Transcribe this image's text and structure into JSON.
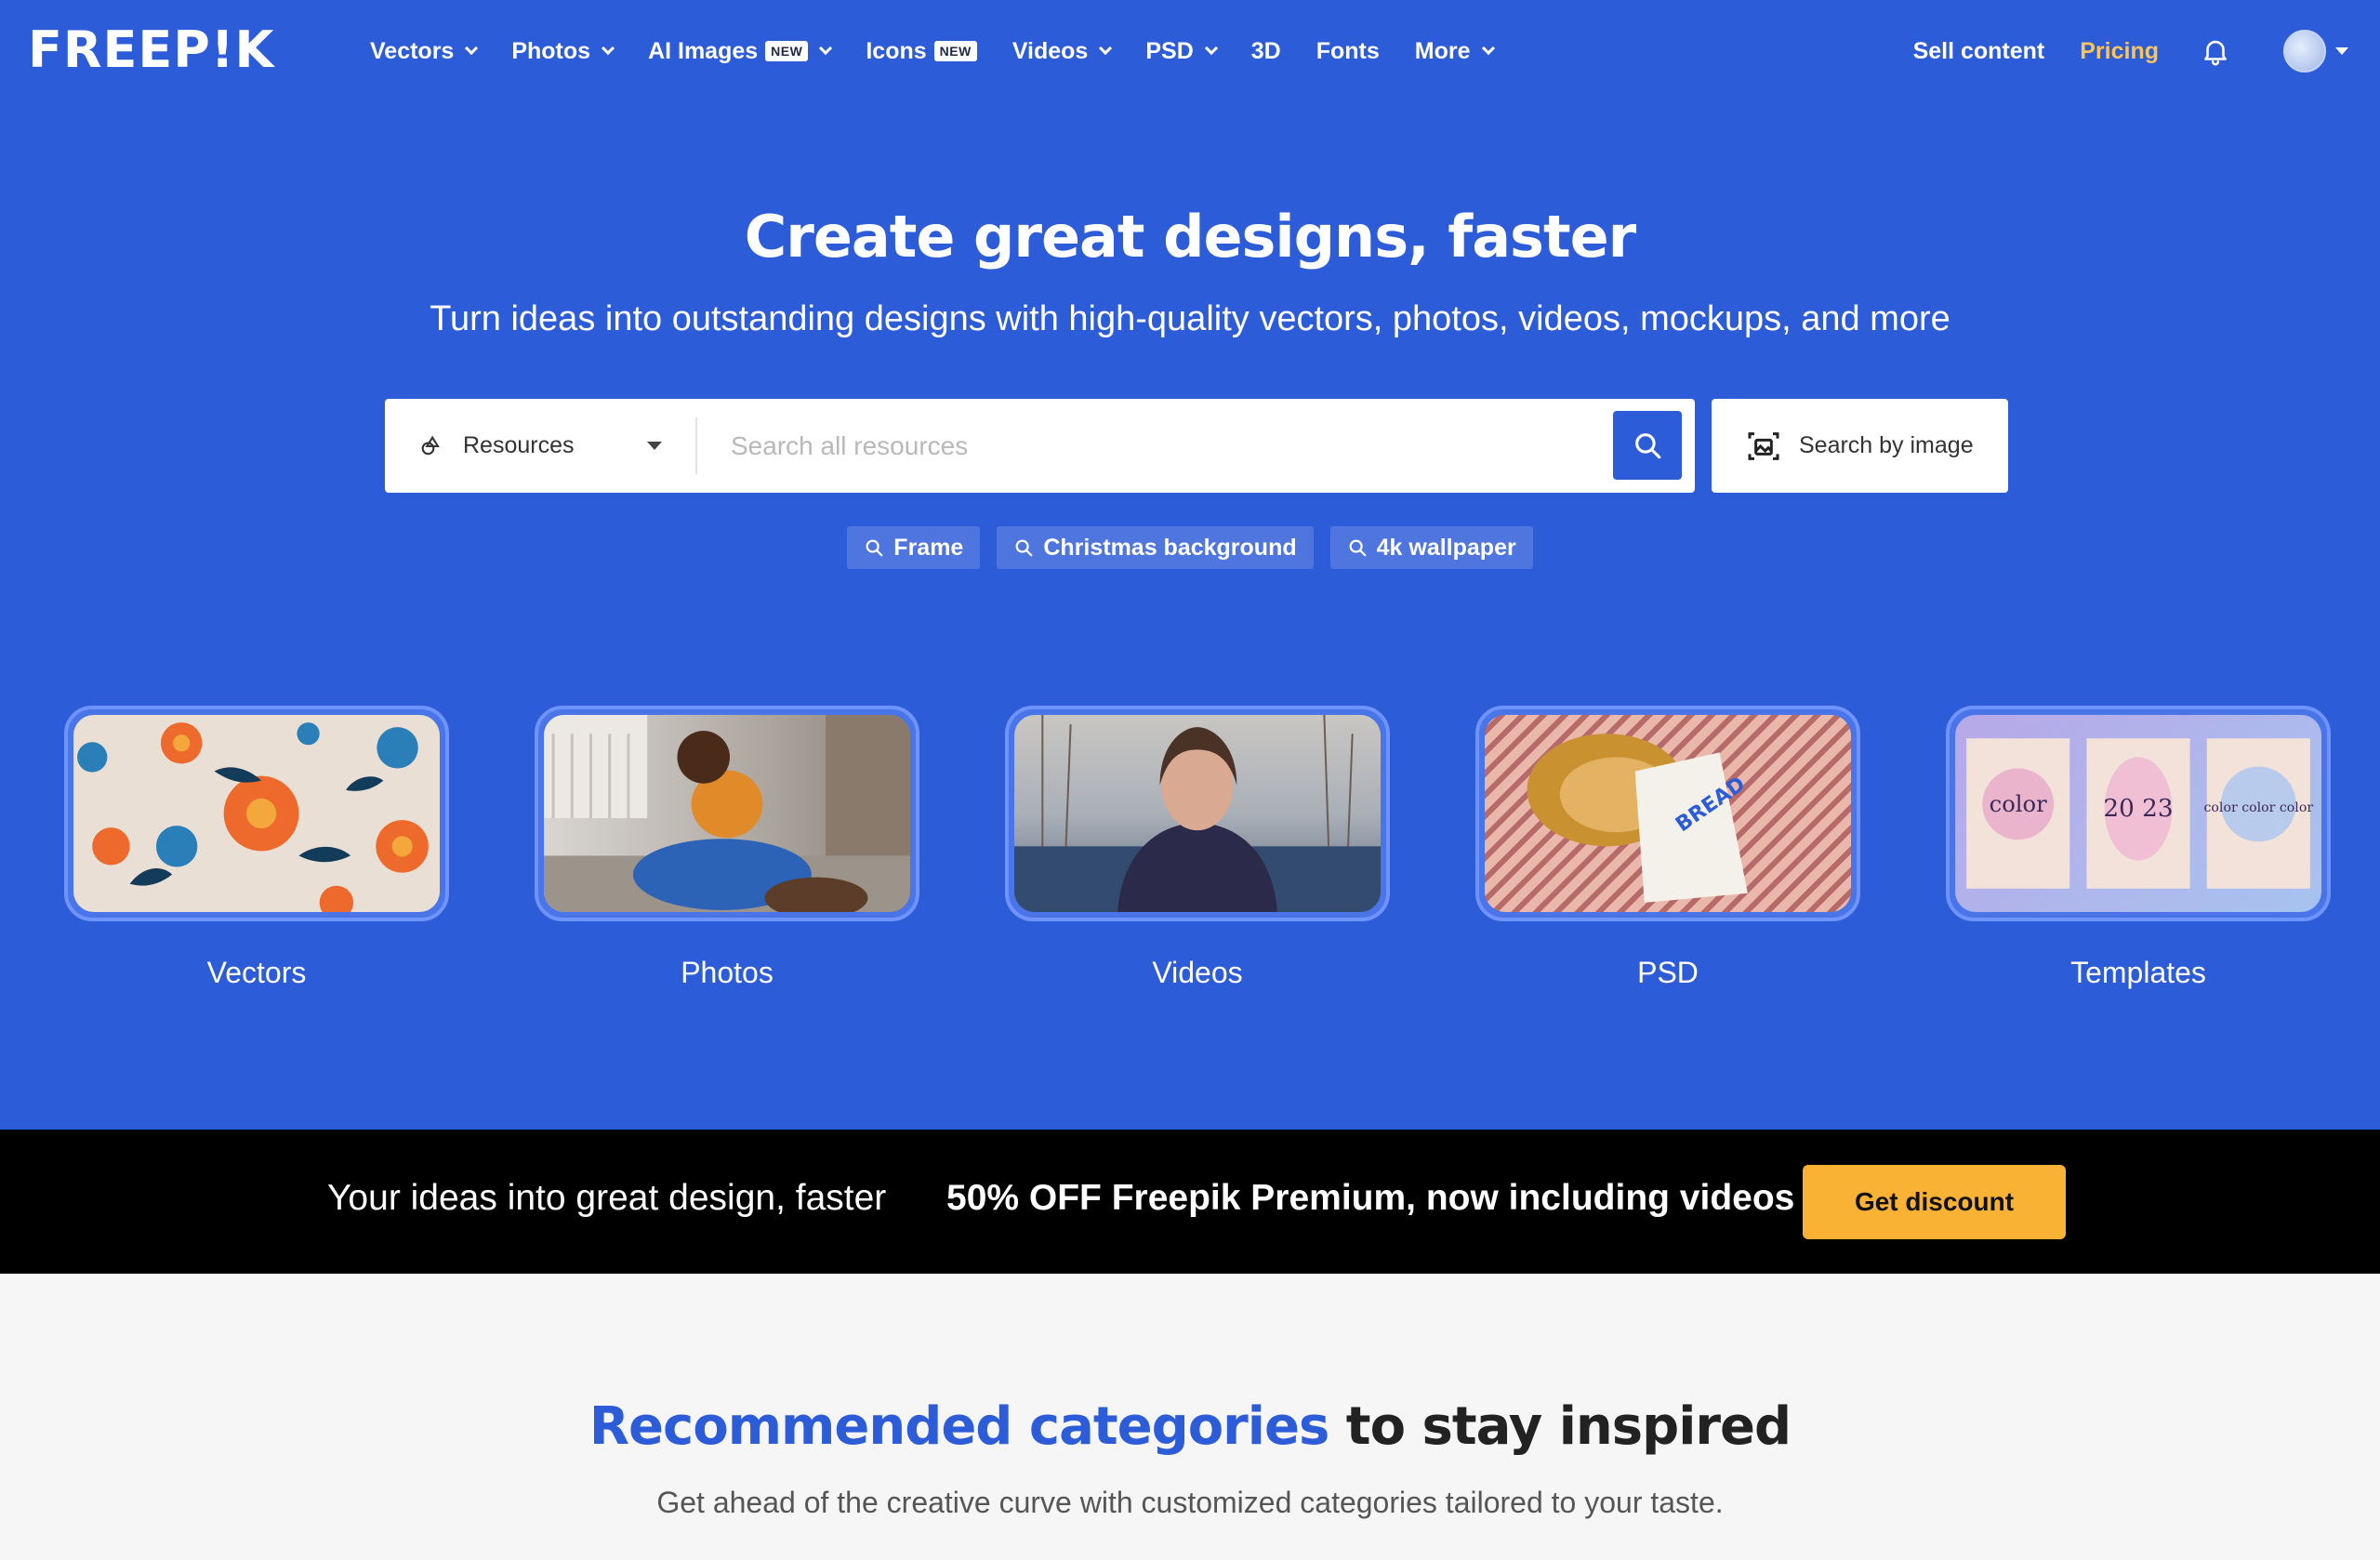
{
  "brand": {
    "logo_text": "FREEP!K"
  },
  "nav": {
    "items": [
      {
        "label": "Vectors",
        "dropdown": true,
        "badge": ""
      },
      {
        "label": "Photos",
        "dropdown": true,
        "badge": ""
      },
      {
        "label": "AI Images",
        "dropdown": true,
        "badge": "NEW"
      },
      {
        "label": "Icons",
        "dropdown": false,
        "badge": "NEW"
      },
      {
        "label": "Videos",
        "dropdown": true,
        "badge": ""
      },
      {
        "label": "PSD",
        "dropdown": true,
        "badge": ""
      },
      {
        "label": "3D",
        "dropdown": false,
        "badge": ""
      },
      {
        "label": "Fonts",
        "dropdown": false,
        "badge": ""
      },
      {
        "label": "More",
        "dropdown": true,
        "badge": ""
      }
    ],
    "sell_label": "Sell content",
    "pricing_label": "Pricing",
    "icons": {
      "notifications": "bell-icon",
      "account": "avatar"
    }
  },
  "hero": {
    "title": "Create great designs, faster",
    "subtitle": "Turn ideas into outstanding designs with high-quality vectors, photos, videos, mockups, and more",
    "search": {
      "resource_selected": "Resources",
      "placeholder": "Search all resources",
      "value": "",
      "image_search_label": "Search by image"
    },
    "suggestions": [
      "Frame",
      "Christmas background",
      "4k wallpaper"
    ],
    "categories": [
      {
        "label": "Vectors",
        "thumb": "vectors"
      },
      {
        "label": "Photos",
        "thumb": "photos"
      },
      {
        "label": "Videos",
        "thumb": "videos"
      },
      {
        "label": "PSD",
        "thumb": "psd"
      },
      {
        "label": "Templates",
        "thumb": "templates"
      }
    ]
  },
  "promo": {
    "tagline": "Your ideas into great design, faster",
    "offer": "50% OFF Freepik Premium, now including videos",
    "button_label": "Get discount"
  },
  "recommended": {
    "title_accent": "Recommended categories",
    "title_rest": " to stay inspired",
    "subtitle": "Get ahead of the creative curve with customized categories tailored to your taste."
  },
  "thumb_text": {
    "psd_label": "BREAD",
    "templates_cards": [
      "color",
      "20 23",
      "color color color"
    ]
  },
  "colors": {
    "brand_blue": "#2d5cd8",
    "pricing": "#f8c55c",
    "promo_bg": "#000000",
    "promo_button": "#f9b233"
  }
}
